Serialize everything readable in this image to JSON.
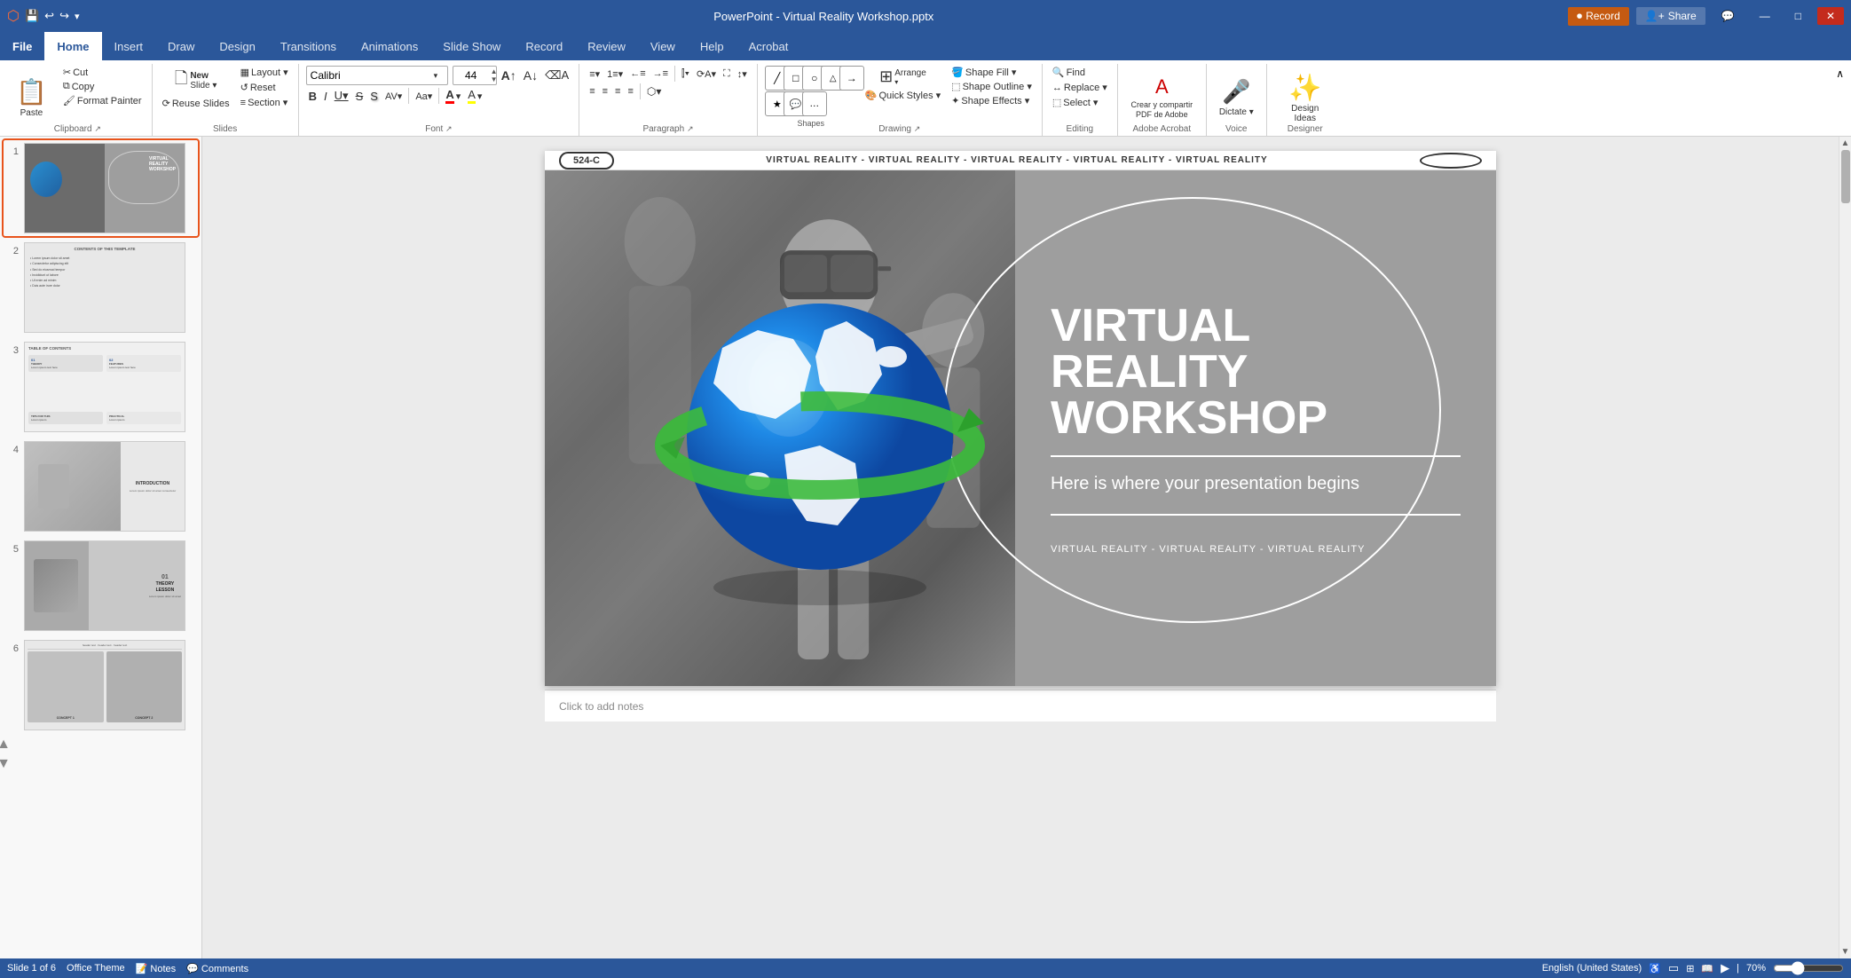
{
  "titlebar": {
    "app_title": "PowerPoint - Virtual Reality Workshop.pptx",
    "record_label": "Record",
    "share_label": "Share",
    "minimize": "—",
    "maximize": "□",
    "close": "✕"
  },
  "ribbon": {
    "tabs": [
      "File",
      "Home",
      "Insert",
      "Draw",
      "Design",
      "Transitions",
      "Animations",
      "Slide Show",
      "Record",
      "Review",
      "View",
      "Help",
      "Acrobat"
    ],
    "active_tab": "Home",
    "groups": {
      "clipboard": {
        "label": "Clipboard",
        "buttons": [
          "Paste",
          "Cut",
          "Copy",
          "Format Painter"
        ]
      },
      "slides": {
        "label": "Slides",
        "buttons": [
          "New Slide",
          "Layout",
          "Reset",
          "Reuse Slides",
          "Section"
        ]
      },
      "font": {
        "label": "Font",
        "font_name": "Calibri",
        "font_size": "44",
        "bold": "B",
        "italic": "I",
        "underline": "U",
        "strikethrough": "S",
        "shadow": "S",
        "char_spacing": "AV",
        "change_case": "Aa",
        "font_color": "A",
        "highlight": "A"
      },
      "paragraph": {
        "label": "Paragraph",
        "buttons": [
          "bullets",
          "numbered",
          "indent-less",
          "indent-more",
          "align-left",
          "align-center",
          "align-right",
          "justify",
          "columns",
          "text-dir",
          "smart-art",
          "line-spacing"
        ]
      },
      "drawing": {
        "label": "Drawing",
        "buttons": [
          "Shapes",
          "Arrange",
          "Quick Styles",
          "Shape Fill",
          "Shape Outline",
          "Shape Effects"
        ]
      },
      "editing": {
        "label": "Editing",
        "buttons": [
          "Find",
          "Replace",
          "Select"
        ]
      },
      "adobe": {
        "label": "Adobe Acrobat",
        "buttons": [
          "Crear y compartir PDF de Adobe"
        ]
      },
      "voice": {
        "label": "Voice",
        "buttons": [
          "Dictate"
        ]
      },
      "designer": {
        "label": "Designer",
        "buttons": [
          "Design Ideas"
        ]
      }
    }
  },
  "slides": [
    {
      "num": "1",
      "type": "title",
      "active": true
    },
    {
      "num": "2",
      "type": "contents"
    },
    {
      "num": "3",
      "type": "toc"
    },
    {
      "num": "4",
      "type": "intro"
    },
    {
      "num": "5",
      "type": "theory"
    },
    {
      "num": "6",
      "type": "concepts"
    }
  ],
  "slide1": {
    "header_tag": "524-C",
    "header_text": "VIRTUAL REALITY  -  VIRTUAL REALITY  -  VIRTUAL REALITY   -  VIRTUAL REALITY   -  VIRTUAL REALITY",
    "title_line1": "VIRTUAL",
    "title_line2": "REALITY",
    "title_line3": "WORKSHOP",
    "subtitle": "Here is where your presentation begins",
    "footer": "VIRTUAL REALITY  -  VIRTUAL REALITY  -  VIRTUAL REALITY"
  },
  "slide2": {
    "title": "CONTENTS OF THIS TEMPLATE"
  },
  "slide3": {
    "title": "TABLE OF CONTENTS"
  },
  "slide4": {
    "title": "INTRODUCTION"
  },
  "slide5": {
    "title": "01\nTHEORY\nLESSON"
  },
  "slide6": {
    "concept1": "CONCEPT 1",
    "concept2": "CONCEPT 2"
  },
  "statusbar": {
    "slide_info": "Slide 1 of 6",
    "theme": "Office Theme",
    "language": "English (United States)",
    "zoom": "70%",
    "notes_placeholder": "Click to add notes"
  }
}
